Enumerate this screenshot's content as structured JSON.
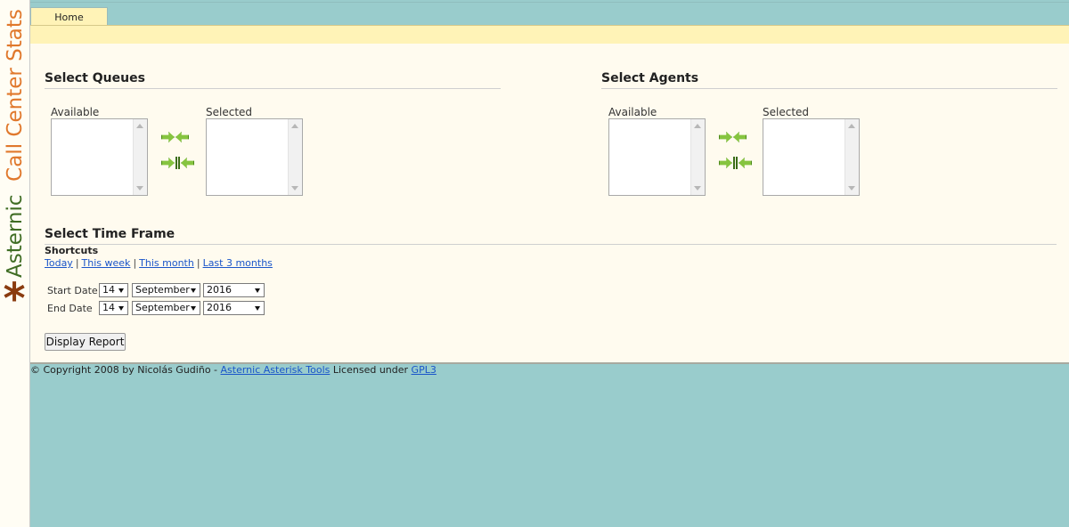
{
  "logo": {
    "part1": "Asternic",
    "part2": "Call Center Stats",
    "star": "*"
  },
  "tabs": [
    {
      "label": "Home"
    }
  ],
  "queues": {
    "title": "Select Queues",
    "available_label": "Available",
    "selected_label": "Selected"
  },
  "agents": {
    "title": "Select Agents",
    "available_label": "Available",
    "selected_label": "Selected"
  },
  "timeframe": {
    "title": "Select Time Frame",
    "shortcuts_label": "Shortcuts",
    "shortcuts": [
      "Today",
      "This week",
      "This month",
      "Last 3 months"
    ],
    "separator": "|",
    "start": {
      "label": "Start Date",
      "day": "14",
      "month": "September",
      "year": "2016"
    },
    "end": {
      "label": "End Date",
      "day": "14",
      "month": "September",
      "year": "2016"
    }
  },
  "display_report_label": "Display Report",
  "footer": {
    "text1": "© Copyright 2008 by Nicolás Gudiño - ",
    "link1": "Asternic Asterisk Tools",
    "text2": " Licensed under ",
    "link2": "GPL3"
  },
  "colors": {
    "background": "#99cccc",
    "panel": "#fffbef",
    "tab_band": "#fff3b7",
    "link": "#1a55c9",
    "logo_green": "#3f6d24",
    "logo_orange": "#e0782c"
  }
}
